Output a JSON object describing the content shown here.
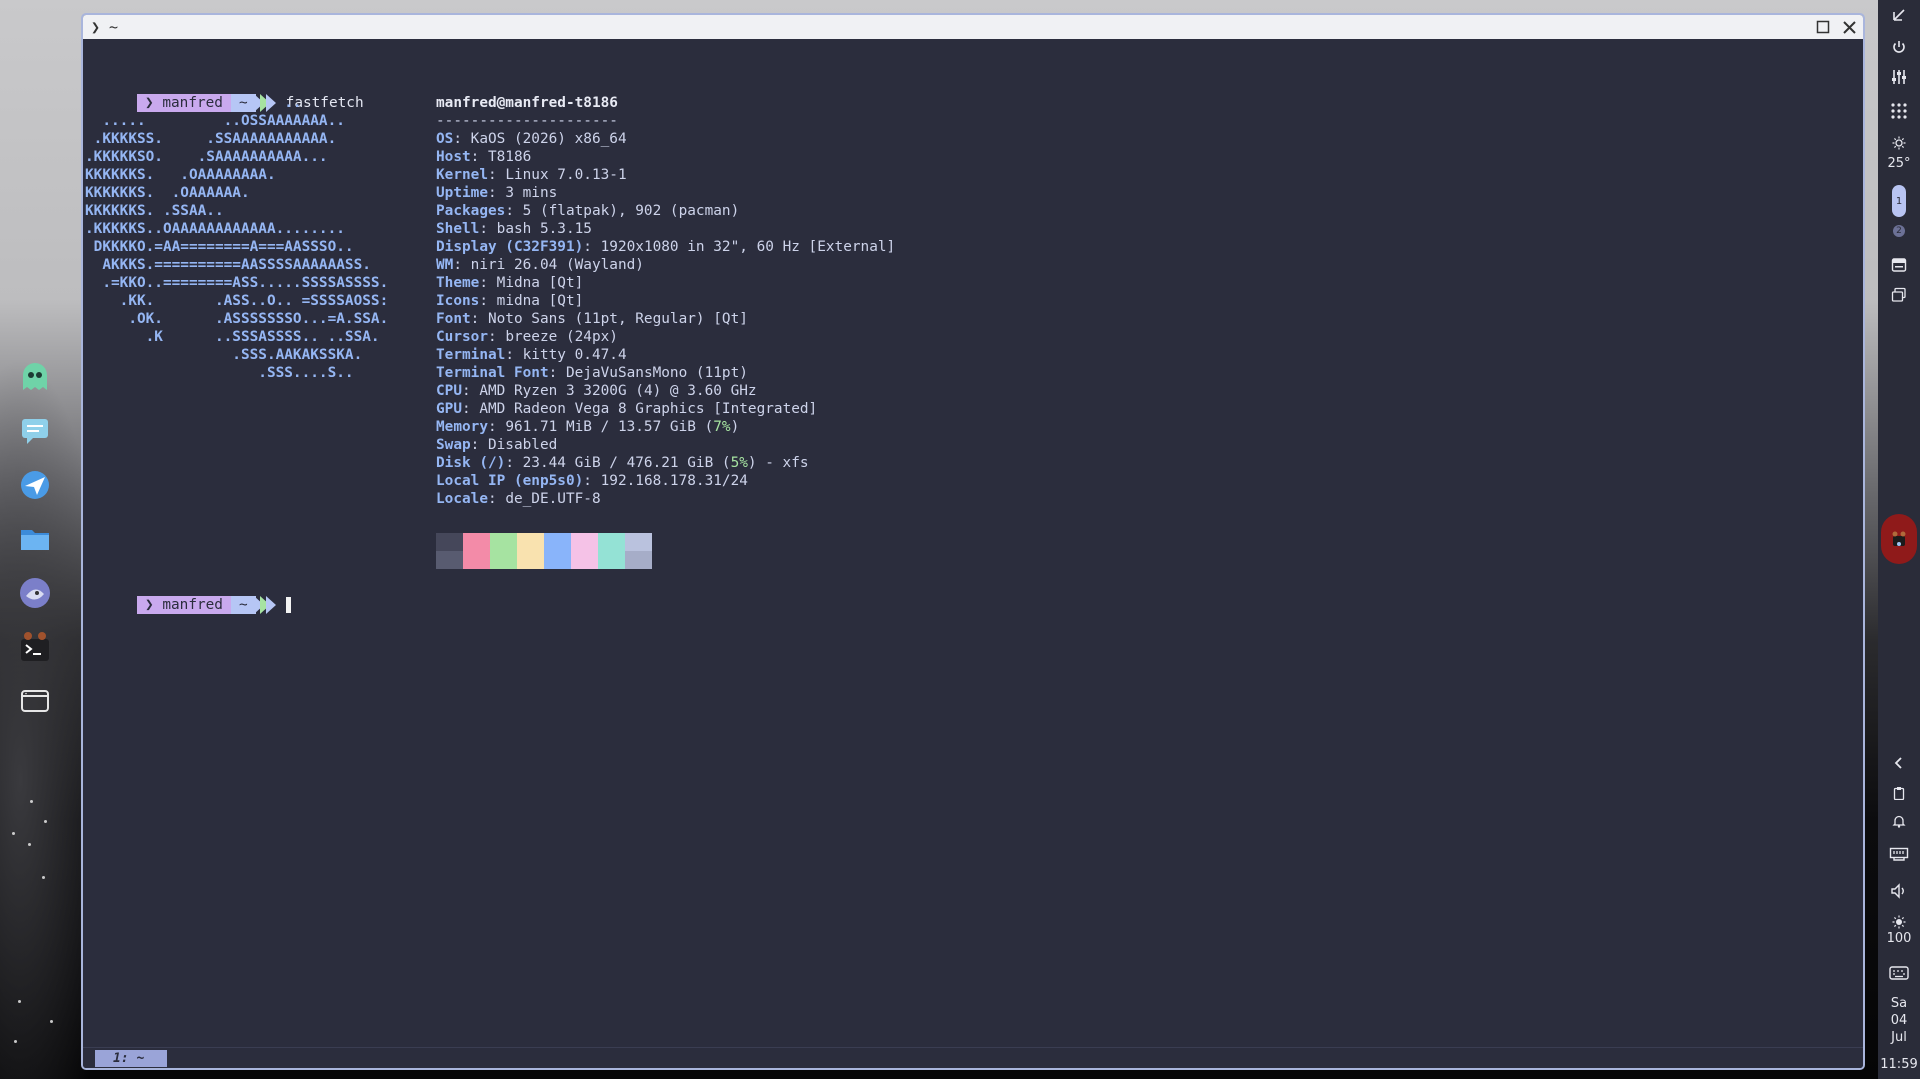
{
  "window": {
    "title": "❯ ~",
    "maximize_icon": "square-icon",
    "close_icon": "x-icon"
  },
  "prompt": {
    "symbol": "❯",
    "user": "manfred",
    "path": "~"
  },
  "command": "fastfetch",
  "logo_lines": [
    "                       ..",
    "  .....         ..OSSAAAAAAA..",
    " .KKKKSS.     .SSAAAAAAAAAAA.",
    ".KKKKKSO.    .SAAAAAAAAAA...",
    "KKKKKKS.   .OAAAAAAAA.",
    "KKKKKKS.  .OAAAAAA.",
    "KKKKKKS. .SSAA..",
    ".KKKKKS..OAAAAAAAAAAAA........",
    " DKKKKO.=AA========A===AASSSO..",
    "  AKKKS.==========AASSSSAAAAAASS.",
    "  .=KKO..========ASS.....SSSSASSSS.",
    "    .KK.       .ASS..O.. =SSSSAOSS:",
    "     .OK.      .ASSSSSSSO...=A.SSA.",
    "       .K      ..SSSASSSS.. ..SSA.",
    "                 .SSS.AAKAKSSKA.",
    "                    .SSS....S.."
  ],
  "sysinfo": {
    "user_host": "manfred@manfred-t8186",
    "separator": "---------------------",
    "rows": [
      {
        "key": "OS",
        "value": "KaOS (2026) x86_64"
      },
      {
        "key": "Host",
        "value": "T8186"
      },
      {
        "key": "Kernel",
        "value": "Linux 7.0.13-1"
      },
      {
        "key": "Uptime",
        "value": "3 mins"
      },
      {
        "key": "Packages",
        "value": "5 (flatpak), 902 (pacman)"
      },
      {
        "key": "Shell",
        "value": "bash 5.3.15"
      },
      {
        "key": "Display (C32F391)",
        "value": "1920x1080 in 32\", 60 Hz [External]"
      },
      {
        "key": "WM",
        "value": "niri 26.04 (Wayland)"
      },
      {
        "key": "Theme",
        "value": "Midna [Qt]"
      },
      {
        "key": "Icons",
        "value": "midna [Qt]"
      },
      {
        "key": "Font",
        "value": "Noto Sans (11pt, Regular) [Qt]"
      },
      {
        "key": "Cursor",
        "value": "breeze (24px)"
      },
      {
        "key": "Terminal",
        "value": "kitty 0.47.4"
      },
      {
        "key": "Terminal Font",
        "value": "DejaVuSansMono (11pt)"
      },
      {
        "key": "CPU",
        "value": "AMD Ryzen 3 3200G (4) @ 3.60 GHz"
      },
      {
        "key": "GPU",
        "value": "AMD Radeon Vega 8 Graphics [Integrated]"
      }
    ],
    "memory": {
      "key": "Memory",
      "pre": "961.71 MiB / 13.57 GiB (",
      "pct": "7%",
      "post": ")"
    },
    "swap": {
      "key": "Swap",
      "value": "Disabled"
    },
    "disk": {
      "key": "Disk (/)",
      "pre": "23.44 GiB / 476.21 GiB (",
      "pct": "5%",
      "post": ") - xfs"
    },
    "rows_after": [
      {
        "key": "Local IP (enp5s0)",
        "value": "192.168.178.31/24"
      },
      {
        "key": "Locale",
        "value": "de_DE.UTF-8"
      }
    ]
  },
  "colors": {
    "palette_top": [
      "#45475a",
      "#f38ba8",
      "#a6e3a1",
      "#f9e2af",
      "#89b4fa",
      "#f5c2e7",
      "#94e2d5",
      "#bac2de"
    ],
    "palette_bottom": [
      "#585b70",
      "#f38ba8",
      "#a6e3a1",
      "#f9e2af",
      "#89b4fa",
      "#f5c2e7",
      "#94e2d5",
      "#a6adc8"
    ],
    "accent": "#a9b5dc",
    "terminal_bg": "#2b2d3d"
  },
  "statusbar": {
    "active_tab": "1: ~"
  },
  "dock": {
    "items": [
      "ghost-app-icon",
      "chat-app-icon",
      "browser-app-icon",
      "file-manager-icon",
      "media-app-icon",
      "terminal-app-icon",
      "window-icon"
    ]
  },
  "right_panel": {
    "temperature": "25°",
    "workspace_active": "1",
    "workspace_other": "2",
    "brightness": "100",
    "day": "Sa",
    "date_day": "04",
    "month": "Jul",
    "time": "11:59"
  }
}
